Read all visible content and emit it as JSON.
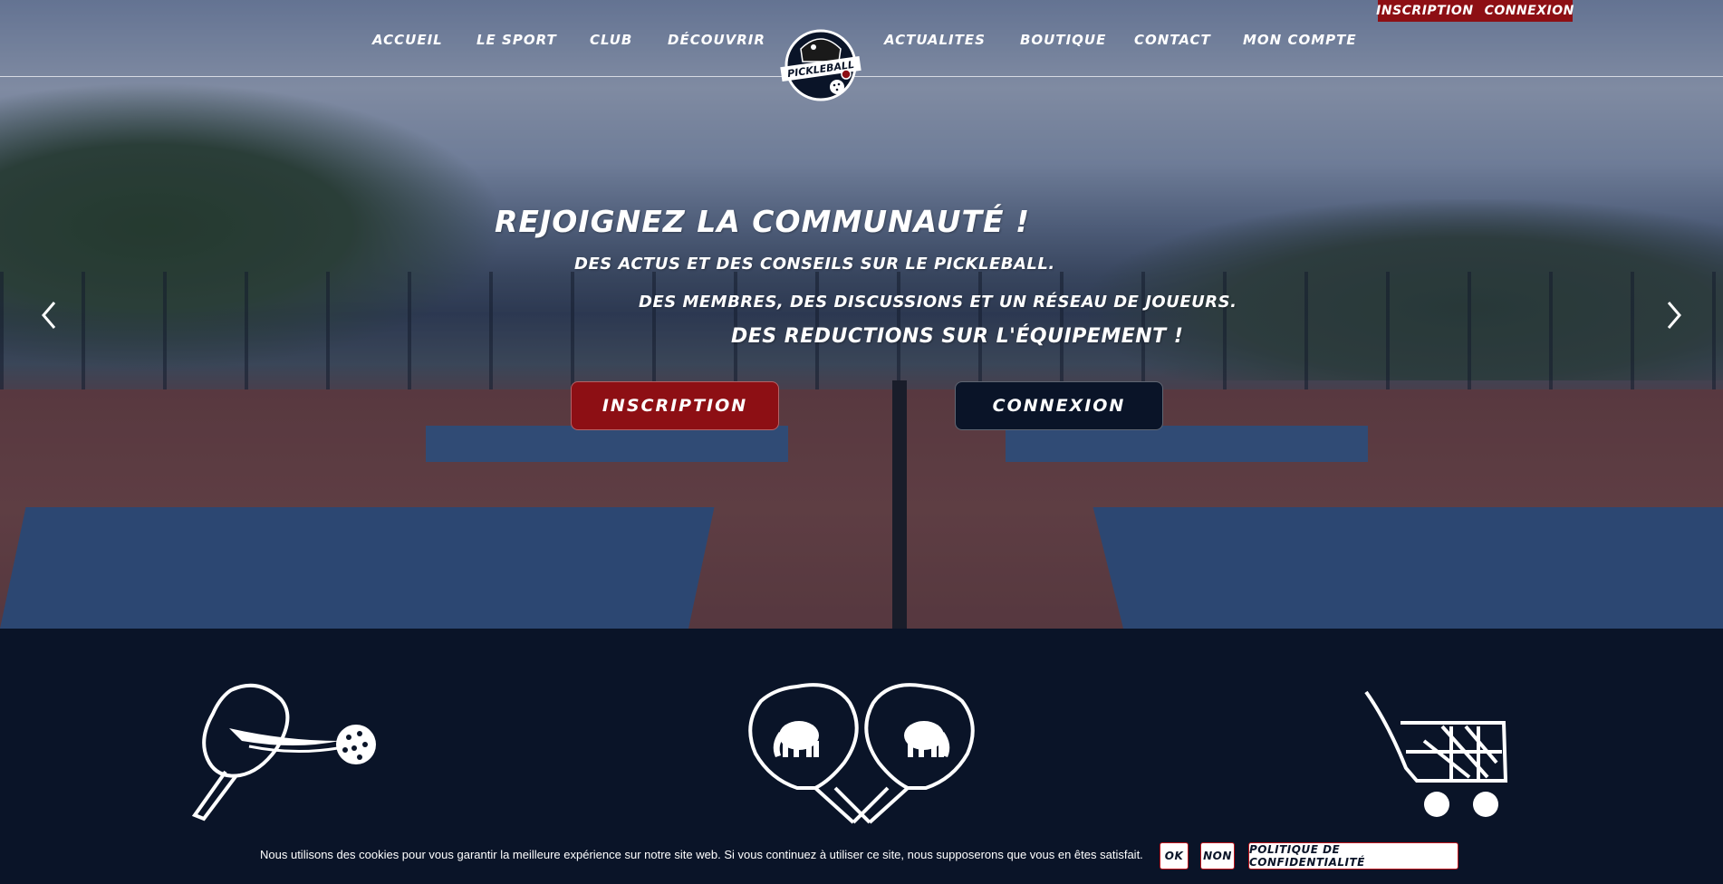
{
  "top_auth": {
    "inscription": "INSCRIPTION",
    "connexion": "CONNEXION"
  },
  "nav": {
    "items": [
      "ACCUEIL",
      "LE SPORT",
      "CLUB",
      "DÉCOUVRIR",
      "ACTUALITES",
      "BOUTIQUE",
      "CONTACT",
      "MON COMPTE"
    ],
    "logo_text": "PICKLEBALL"
  },
  "hero": {
    "title": "REJOIGNEZ LA COMMUNAUTÉ !",
    "line1": "DES ACTUS ET DES CONSEILS SUR LE PICKLEBALL.",
    "line2": "DES MEMBRES, DES DISCUSSIONS ET UN RÉSEAU DE JOUEURS.",
    "line3": "DES REDUCTIONS SUR L'ÉQUIPEMENT !",
    "btn_inscription": "INSCRIPTION",
    "btn_connexion": "CONNEXION"
  },
  "features": {
    "icons": [
      "paddle-ball-icon",
      "crossed-paddles-mammoth-icon",
      "shopping-cart-icon"
    ]
  },
  "cookie": {
    "text": "Nous utilisons des cookies pour vous garantir la meilleure expérience sur notre site web. Si vous continuez à utiliser ce site, nous supposerons que vous en êtes satisfait.",
    "ok": "OK",
    "non": "NON",
    "policy": "POLITIQUE DE CONFIDENTIALITÉ"
  },
  "colors": {
    "brand_red": "#8d0f14",
    "navy": "#0a1428",
    "white": "#ffffff"
  }
}
